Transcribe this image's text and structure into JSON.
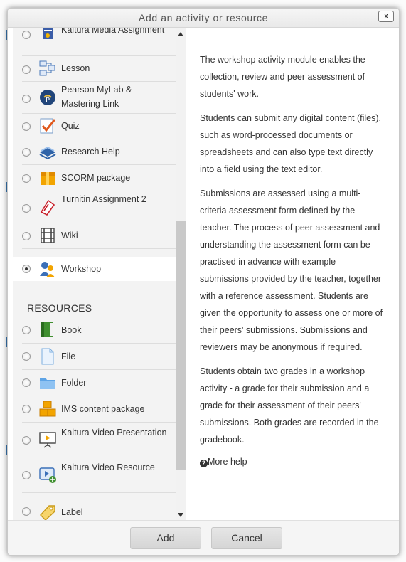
{
  "dialog": {
    "title": "Add an activity or resource",
    "close_label": "x"
  },
  "activities": [
    {
      "label": "Kaltura Media Assignment",
      "icon": "kaltura-media-assignment-icon"
    },
    {
      "label": "Lesson",
      "icon": "lesson-icon"
    },
    {
      "label": "Pearson MyLab & Mastering Link",
      "icon": "pearson-icon"
    },
    {
      "label": "Quiz",
      "icon": "quiz-icon"
    },
    {
      "label": "Research Help",
      "icon": "research-help-icon"
    },
    {
      "label": "SCORM package",
      "icon": "scorm-icon"
    },
    {
      "label": "Turnitin Assignment 2",
      "icon": "turnitin-icon"
    },
    {
      "label": "Wiki",
      "icon": "wiki-icon"
    },
    {
      "label": "Workshop",
      "icon": "workshop-icon",
      "selected": true
    }
  ],
  "resources_heading": "RESOURCES",
  "resources": [
    {
      "label": "Book",
      "icon": "book-icon"
    },
    {
      "label": "File",
      "icon": "file-icon"
    },
    {
      "label": "Folder",
      "icon": "folder-icon"
    },
    {
      "label": "IMS content package",
      "icon": "ims-package-icon"
    },
    {
      "label": "Kaltura Video Presentation",
      "icon": "kaltura-video-presentation-icon"
    },
    {
      "label": "Kaltura Video Resource",
      "icon": "kaltura-video-resource-icon"
    },
    {
      "label": "Label",
      "icon": "label-icon"
    }
  ],
  "description": {
    "paragraphs": [
      "The workshop activity module enables the collection, review and peer assessment of students' work.",
      "Students can submit any digital content (files), such as word-processed documents or spreadsheets and can also type text directly into a field using the text editor.",
      "Submissions are assessed using a multi-criteria assessment form defined by the teacher. The process of peer assessment and understanding the assessment form can be practised in advance with example submissions provided by the teacher, together with a reference assessment. Students are given the opportunity to assess one or more of their peers' submissions. Submissions and reviewers may be anonymous if required.",
      "Students obtain two grades in a workshop activity - a grade for their submission and a grade for their assessment of their peers' submissions. Both grades are recorded in the gradebook."
    ],
    "more_help": "More help"
  },
  "footer": {
    "add_label": "Add",
    "cancel_label": "Cancel"
  }
}
